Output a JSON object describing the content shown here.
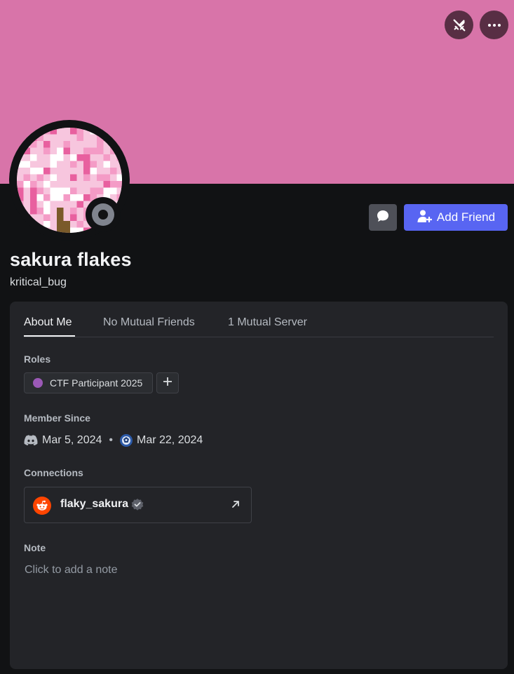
{
  "banner": {
    "color": "#d874a9",
    "buttons": [
      {
        "icon": "swords-icon"
      },
      {
        "icon": "more-options-icon"
      }
    ]
  },
  "profile": {
    "display_name": "sakura flakes",
    "username": "kritical_bug",
    "status": "offline",
    "status_color": "#80848e"
  },
  "actions": {
    "message_icon": "chat-bubble-icon",
    "add_friend_label": "Add Friend",
    "add_friend_color": "#5865f2"
  },
  "tabs": [
    {
      "label": "About Me",
      "active": true
    },
    {
      "label": "No Mutual Friends",
      "active": false
    },
    {
      "label": "1 Mutual Server",
      "active": false
    }
  ],
  "roles": {
    "heading": "Roles",
    "items": [
      {
        "name": "CTF Participant 2025",
        "color": "#9b59b6"
      }
    ],
    "add_icon": "plus-icon"
  },
  "member_since": {
    "heading": "Member Since",
    "discord_date": "Mar 5, 2024",
    "separator": "•",
    "server_date": "Mar 22, 2024"
  },
  "connections": {
    "heading": "Connections",
    "items": [
      {
        "service": "reddit",
        "name": "flaky_sakura",
        "verified": true
      }
    ]
  },
  "note": {
    "heading": "Note",
    "placeholder": "Click to add a note"
  }
}
